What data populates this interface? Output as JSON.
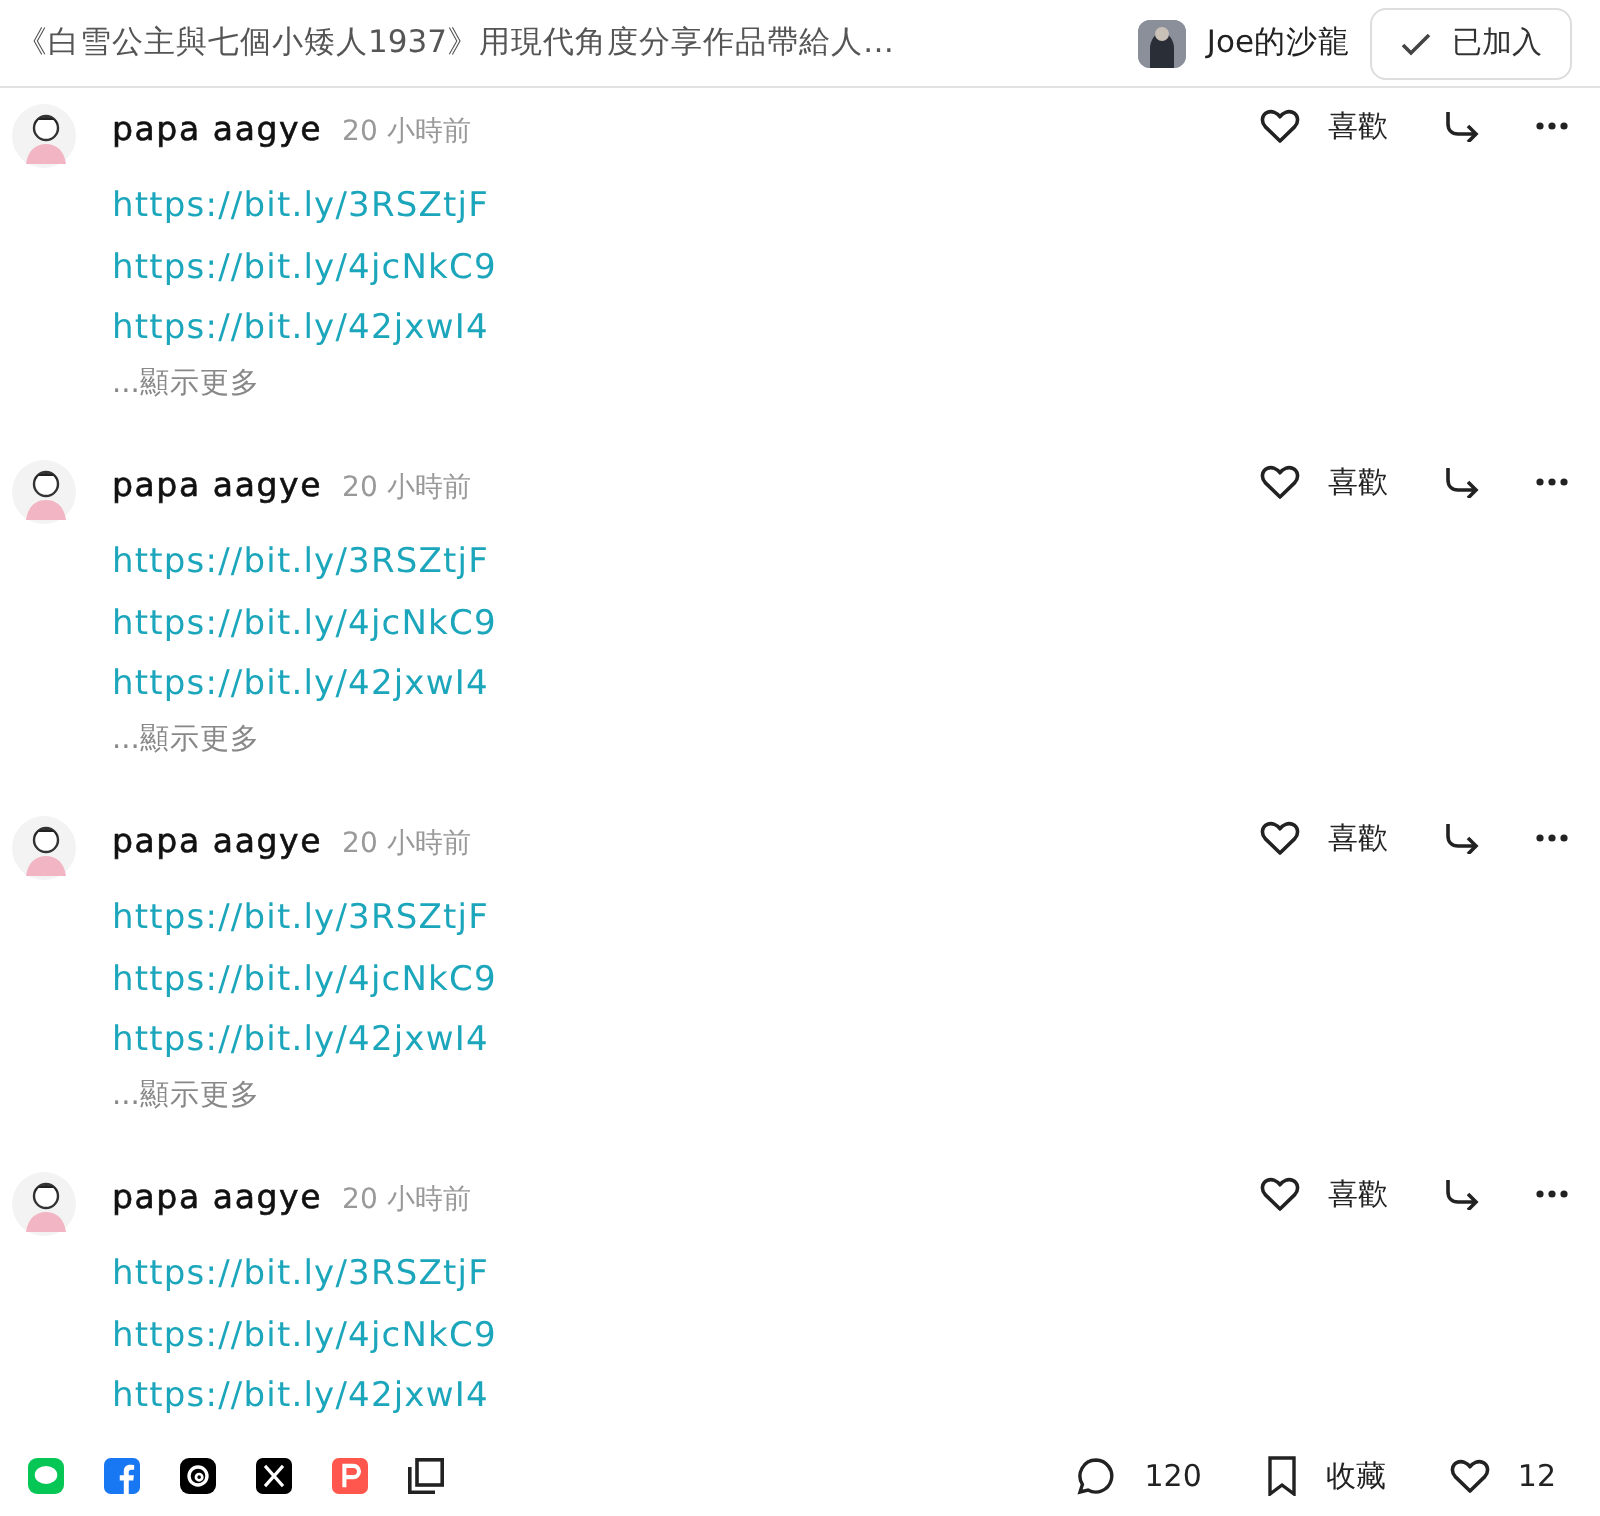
{
  "header": {
    "title": "《白雪公主與七個小矮人1937》用現代角度分享作品帶給人…",
    "salon": "Joe的沙龍",
    "join_button": {
      "label": "已加入",
      "joined": true
    }
  },
  "comments": [
    {
      "author": "papa aagye",
      "time": "20 小時前",
      "like_label": "喜歡",
      "links": [
        "https://bit.ly/3RSZtjF",
        "https://bit.ly/4jcNkC9",
        "https://bit.ly/42jxwI4"
      ],
      "more": "...顯示更多"
    },
    {
      "author": "papa aagye",
      "time": "20 小時前",
      "like_label": "喜歡",
      "links": [
        "https://bit.ly/3RSZtjF",
        "https://bit.ly/4jcNkC9",
        "https://bit.ly/42jxwI4"
      ],
      "more": "...顯示更多"
    },
    {
      "author": "papa aagye",
      "time": "20 小時前",
      "like_label": "喜歡",
      "links": [
        "https://bit.ly/3RSZtjF",
        "https://bit.ly/4jcNkC9",
        "https://bit.ly/42jxwI4"
      ],
      "more": "...顯示更多"
    },
    {
      "author": "papa aagye",
      "time": "20 小時前",
      "like_label": "喜歡",
      "links": [
        "https://bit.ly/3RSZtjF",
        "https://bit.ly/4jcNkC9",
        "https://bit.ly/42jxwI4"
      ]
    }
  ],
  "footer": {
    "share": [
      {
        "kind": "line",
        "color": "#06c755"
      },
      {
        "kind": "facebook",
        "color": "#1877f2"
      },
      {
        "kind": "threads",
        "color": "#000000"
      },
      {
        "kind": "x",
        "color": "#000000"
      },
      {
        "kind": "plurk",
        "color": "#ff574d"
      },
      {
        "kind": "copy",
        "color": "#222222"
      }
    ],
    "comment_count": "120",
    "bookmark_label": "收藏",
    "like_count": "12"
  }
}
